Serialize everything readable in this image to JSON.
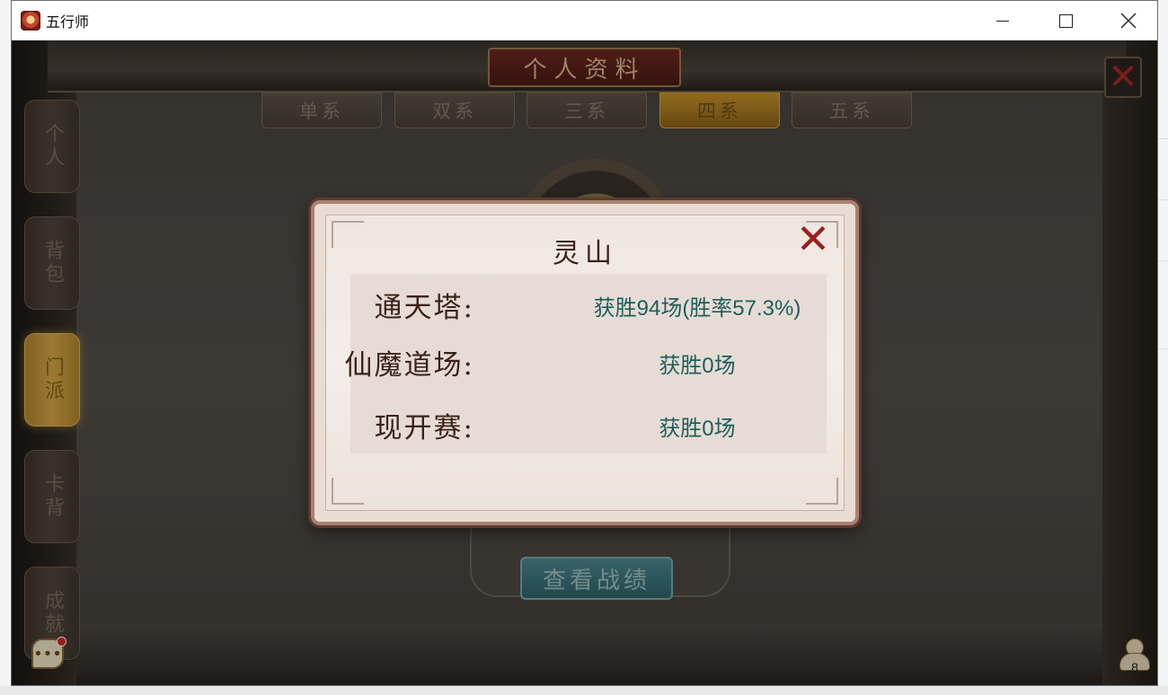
{
  "window": {
    "title": "五行师",
    "controls": {
      "minimize": "minimize",
      "maximize": "maximize",
      "close": "close"
    }
  },
  "game": {
    "page_title": "个人资料",
    "tabs": [
      {
        "label": "单系",
        "active": false
      },
      {
        "label": "双系",
        "active": false
      },
      {
        "label": "三系",
        "active": false
      },
      {
        "label": "四系",
        "active": true
      },
      {
        "label": "五系",
        "active": false
      }
    ],
    "side_tabs": [
      {
        "label": "个人",
        "active": false
      },
      {
        "label": "背包",
        "active": false
      },
      {
        "label": "门派",
        "active": true
      },
      {
        "label": "卡背",
        "active": false
      },
      {
        "label": "成就",
        "active": false
      }
    ],
    "view_record_button": "查看战绩",
    "online_count": "8"
  },
  "modal": {
    "title": "灵山",
    "rows": [
      {
        "label": "通天塔:",
        "value": "获胜94场(胜率57.3%)"
      },
      {
        "label": "仙魔道场:",
        "value": "获胜0场"
      },
      {
        "label": "现开赛:",
        "value": "获胜0场"
      }
    ]
  },
  "colors": {
    "value_text": "#1d5f5a",
    "label_text": "#3b2218",
    "close_x": "#9e1f1b",
    "active_tab": "#c8932a"
  },
  "icons": {
    "app": "wuxingshi-app-icon",
    "close": "close-x-icon",
    "chat": "chat-bubble-icon",
    "people": "online-players-icon"
  }
}
